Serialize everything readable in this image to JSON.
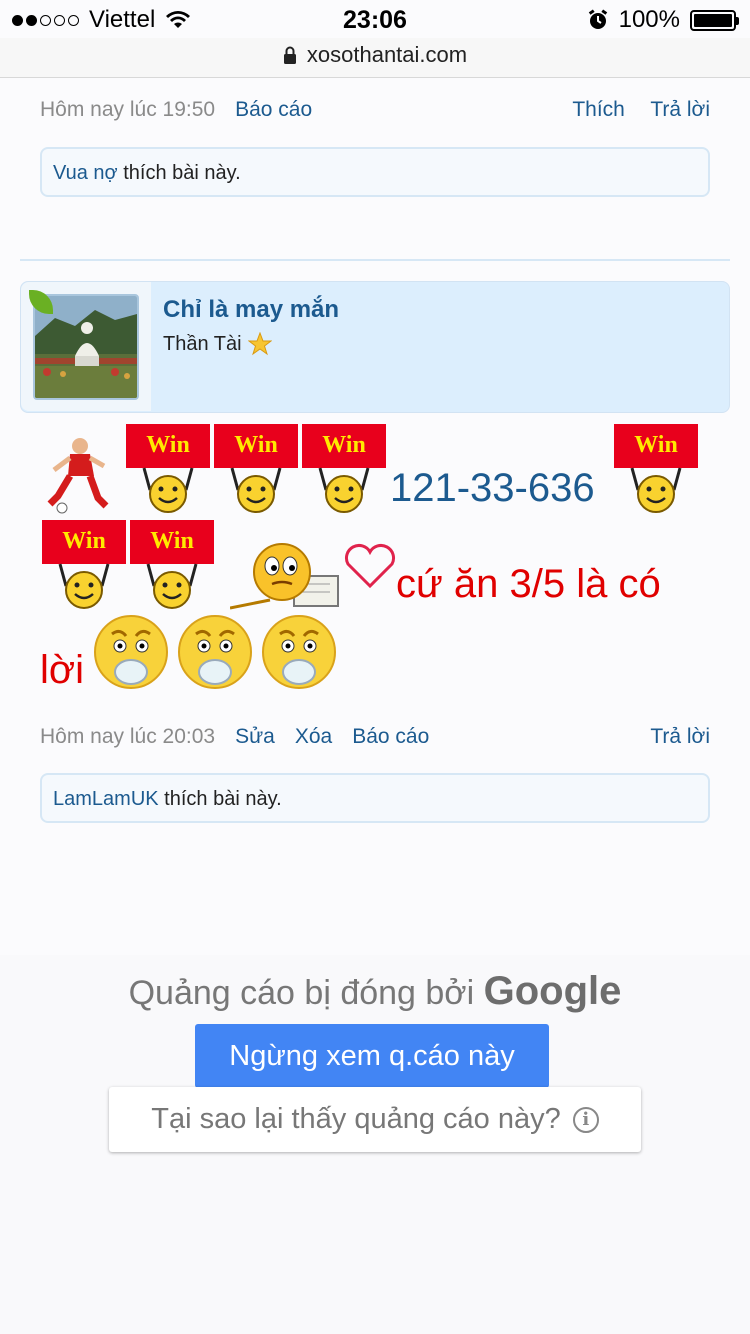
{
  "status": {
    "carrier": "Viettel",
    "time": "23:06",
    "battery": "100%"
  },
  "browser": {
    "url": "xosothantai.com"
  },
  "prev_post": {
    "time": "Hôm nay lúc 19:50",
    "report": "Báo cáo",
    "like": "Thích",
    "reply": "Trả lời",
    "liked_by": "Vua nợ",
    "liked_suffix": "thích bài này."
  },
  "post": {
    "username": "Chỉ là may mắn",
    "user_title": "Thần Tài",
    "win_label": "Win",
    "numbers": "121-33-636",
    "message_line1": "cứ ăn 3/5 là có",
    "message_line2": "lời",
    "time": "Hôm nay lúc 20:03",
    "edit": "Sửa",
    "delete": "Xóa",
    "report": "Báo cáo",
    "reply": "Trả lời",
    "liked_by": "LamLamUK",
    "liked_suffix": "thích bài này."
  },
  "ad": {
    "closed_prefix": "Quảng cáo bị đóng bởi",
    "google": "Google",
    "stop_button": "Ngừng xem q.cáo này",
    "why_button": "Tại sao lại thấy quảng cáo này?"
  },
  "colors": {
    "link": "#1c5a8f",
    "red_text": "#e00000",
    "ad_button": "#4285f4"
  }
}
